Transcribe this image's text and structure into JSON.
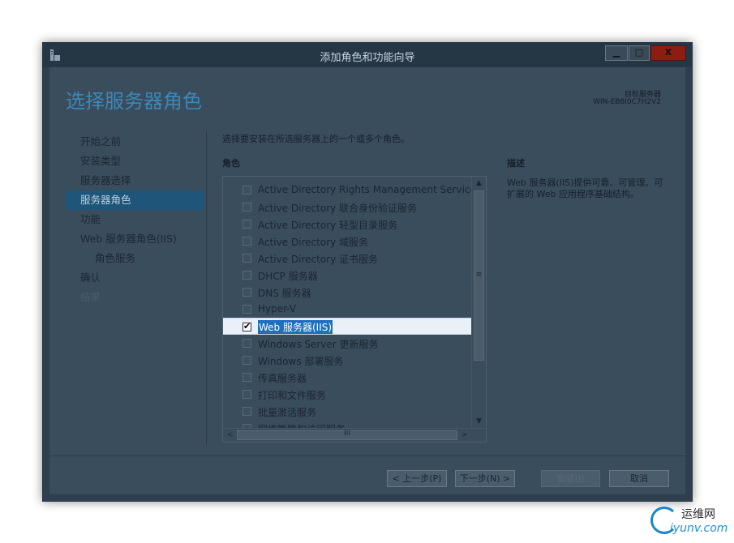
{
  "window": {
    "title": "添加角色和功能向导",
    "minimize_glyph": "▁",
    "maximize_glyph": "□",
    "close_glyph": "X"
  },
  "header": {
    "page_title": "选择服务器角色",
    "target_label": "目标服务器",
    "target_name": "WIN-EB8I0C7H2V2"
  },
  "nav": {
    "items": [
      {
        "label": "开始之前"
      },
      {
        "label": "安装类型"
      },
      {
        "label": "服务器选择"
      },
      {
        "label": "服务器角色"
      },
      {
        "label": "功能"
      },
      {
        "label": "Web 服务器角色(IIS)"
      },
      {
        "label": "角色服务"
      },
      {
        "label": "确认"
      },
      {
        "label": "结果"
      }
    ],
    "active_index": 3
  },
  "main": {
    "instruction": "选择要安装在所选服务器上的一个或多个角色。",
    "roles_heading": "角色",
    "roles": [
      {
        "label": "Active Directory Rights Management Services",
        "checked": false
      },
      {
        "label": "Active Directory 联合身份验证服务",
        "checked": false
      },
      {
        "label": "Active Directory 轻型目录服务",
        "checked": false
      },
      {
        "label": "Active Directory 域服务",
        "checked": false
      },
      {
        "label": "Active Directory 证书服务",
        "checked": false
      },
      {
        "label": "DHCP 服务器",
        "checked": false
      },
      {
        "label": "DNS 服务器",
        "checked": false
      },
      {
        "label": "Hyper-V",
        "checked": false
      },
      {
        "label": "Web 服务器(IIS)",
        "checked": true
      },
      {
        "label": "Windows Server 更新服务",
        "checked": false
      },
      {
        "label": "Windows 部署服务",
        "checked": false
      },
      {
        "label": "传真服务器",
        "checked": false
      },
      {
        "label": "打印和文件服务",
        "checked": false
      },
      {
        "label": "批量激活服务",
        "checked": false
      },
      {
        "label": "网络策略和访问服务",
        "checked": false
      }
    ],
    "scroll_up_glyph": "▲",
    "scroll_down_glyph": "▼",
    "scroll_left_glyph": "<",
    "scroll_right_glyph": ">",
    "vgrip_glyph": "≡",
    "hgrip_glyph": "III",
    "check_glyph": "✔",
    "description_heading": "描述",
    "description_text": "Web 服务器(IIS)提供可靠、可管理、可扩展的 Web 应用程序基础结构。"
  },
  "footer": {
    "prev_label": "< 上一步(P)",
    "next_label": "下一步(N) >",
    "install_label": "安装(I)",
    "cancel_label": "取消"
  },
  "watermark": {
    "cn": "运维网",
    "en": "iyunv.com"
  }
}
